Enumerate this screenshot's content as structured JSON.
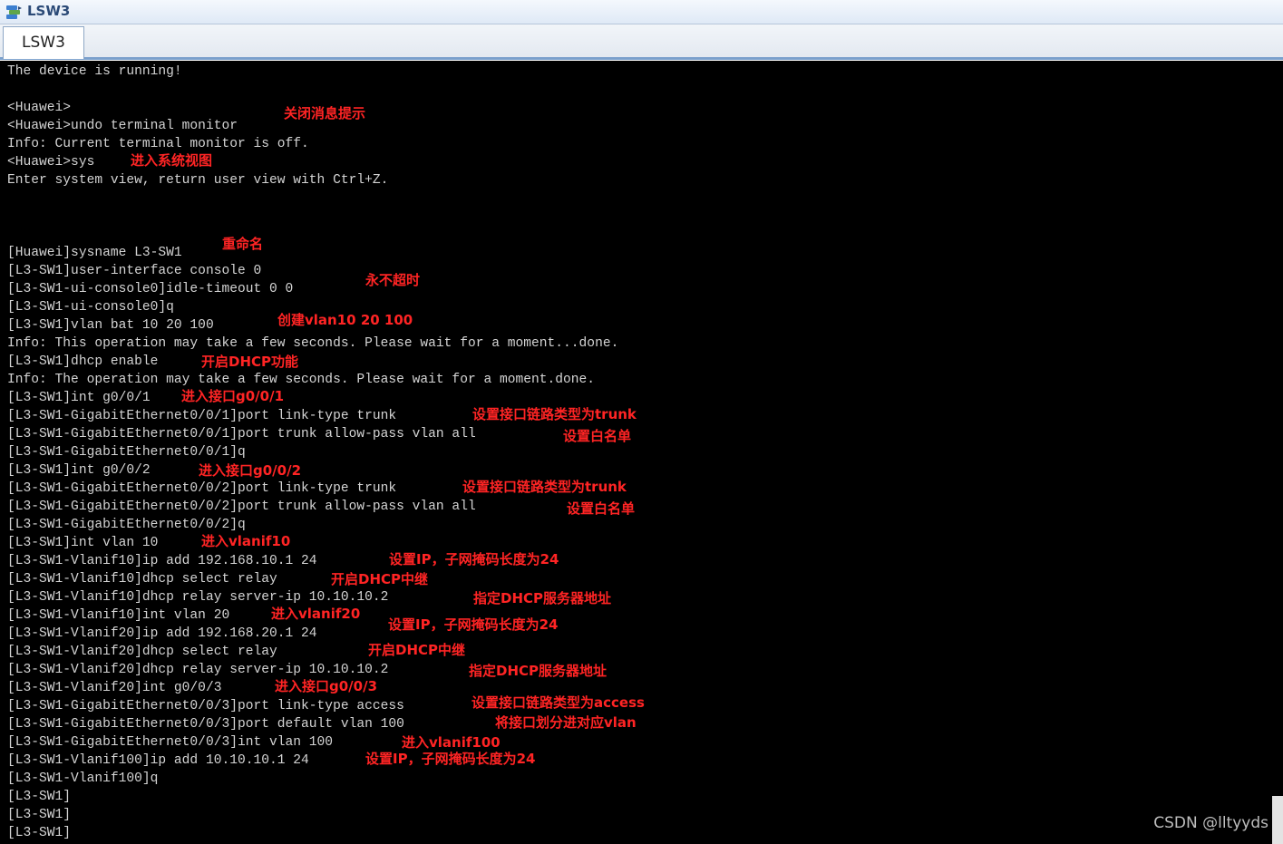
{
  "window": {
    "title": "LSW3",
    "app_icon": "eNSP-switch-icon"
  },
  "tabs": [
    {
      "label": "LSW3",
      "active": true
    }
  ],
  "console": {
    "text_color": "#d4d4d4",
    "background": "#000000",
    "lines": [
      "The device is running!",
      "",
      "<Huawei>",
      "<Huawei>undo terminal monitor",
      "Info: Current terminal monitor is off.",
      "<Huawei>sys",
      "Enter system view, return user view with Ctrl+Z.",
      "",
      "",
      "",
      "[Huawei]sysname L3-SW1",
      "[L3-SW1]user-interface console 0",
      "[L3-SW1-ui-console0]idle-timeout 0 0",
      "[L3-SW1-ui-console0]q",
      "[L3-SW1]vlan bat 10 20 100",
      "Info: This operation may take a few seconds. Please wait for a moment...done.",
      "[L3-SW1]dhcp enable",
      "Info: The operation may take a few seconds. Please wait for a moment.done.",
      "[L3-SW1]int g0/0/1",
      "[L3-SW1-GigabitEthernet0/0/1]port link-type trunk",
      "[L3-SW1-GigabitEthernet0/0/1]port trunk allow-pass vlan all",
      "[L3-SW1-GigabitEthernet0/0/1]q",
      "[L3-SW1]int g0/0/2",
      "[L3-SW1-GigabitEthernet0/0/2]port link-type trunk",
      "[L3-SW1-GigabitEthernet0/0/2]port trunk allow-pass vlan all",
      "[L3-SW1-GigabitEthernet0/0/2]q",
      "[L3-SW1]int vlan 10",
      "[L3-SW1-Vlanif10]ip add 192.168.10.1 24",
      "[L3-SW1-Vlanif10]dhcp select relay",
      "[L3-SW1-Vlanif10]dhcp relay server-ip 10.10.10.2",
      "[L3-SW1-Vlanif10]int vlan 20",
      "[L3-SW1-Vlanif20]ip add 192.168.20.1 24",
      "[L3-SW1-Vlanif20]dhcp select relay",
      "[L3-SW1-Vlanif20]dhcp relay server-ip 10.10.10.2",
      "[L3-SW1-Vlanif20]int g0/0/3",
      "[L3-SW1-GigabitEthernet0/0/3]port link-type access",
      "[L3-SW1-GigabitEthernet0/0/3]port default vlan 100",
      "[L3-SW1-GigabitEthernet0/0/3]int vlan 100",
      "[L3-SW1-Vlanif100]ip add 10.10.10.1 24",
      "[L3-SW1-Vlanif100]q",
      "[L3-SW1]",
      "[L3-SW1]",
      "[L3-SW1]"
    ]
  },
  "annotations": {
    "color": "#ff2424",
    "items": [
      "关闭消息提示",
      "进入系统视图",
      "重命名",
      "永不超时",
      "创建vlan10 20 100",
      "开启DHCP功能",
      "进入接口g0/0/1",
      "设置接口链路类型为trunk",
      "设置白名单",
      "进入接口g0/0/2",
      "设置接口链路类型为trunk",
      "设置白名单",
      "进入vlanif10",
      "设置IP，子网掩码长度为24",
      "开启DHCP中继",
      "指定DHCP服务器地址",
      "进入vlanif20",
      "设置IP，子网掩码长度为24",
      "开启DHCP中继",
      "指定DHCP服务器地址",
      "进入接口g0/0/3",
      "设置接口链路类型为access",
      "将接口划分进对应vlan",
      "进入vlanif100",
      "设置IP，子网掩码长度为24"
    ]
  },
  "watermark": "CSDN @lltyyds"
}
